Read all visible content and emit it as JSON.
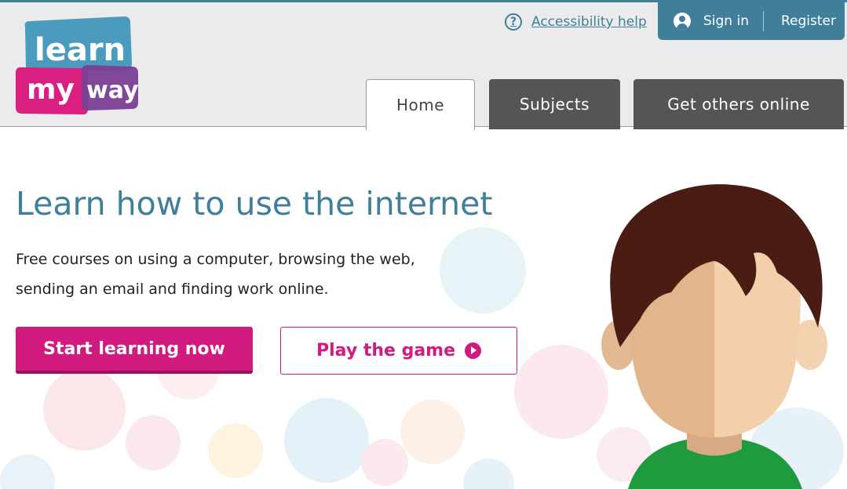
{
  "logo": {
    "line1": "learn",
    "line2": "my",
    "line3": "way"
  },
  "header": {
    "accessibility_help": "Accessibility help",
    "sign_in": "Sign in",
    "register": "Register"
  },
  "nav": {
    "tabs": [
      {
        "label": "Home",
        "active": true
      },
      {
        "label": "Subjects",
        "active": false
      },
      {
        "label": "Get others online",
        "active": false
      }
    ]
  },
  "hero": {
    "title": "Learn how to use the internet",
    "text_line1": "Free courses on using a computer, browsing the web,",
    "text_line2": "sending an email and finding work online.",
    "start_button": "Start learning now",
    "game_button": "Play the game"
  },
  "colors": {
    "brand_teal": "#3f7f99",
    "brand_pink": "#d11a7e",
    "tab_dark": "#555555",
    "logo_blue": "#4a9bbd",
    "logo_purple": "#7b3f96"
  },
  "icons": [
    "question-circle-icon",
    "user-circle-icon",
    "play-circle-icon"
  ]
}
